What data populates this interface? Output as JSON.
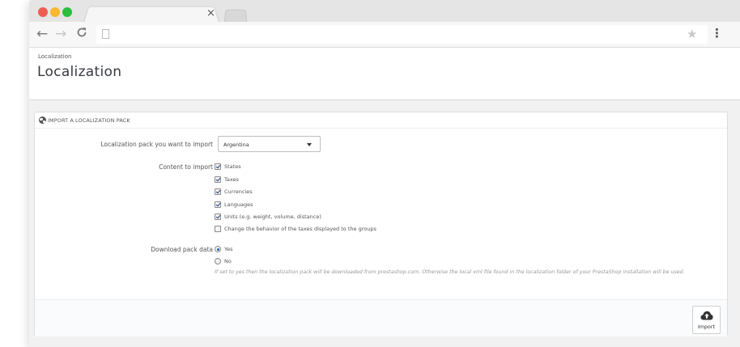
{
  "browser": {
    "tab_close": "×",
    "nav": {
      "back": "←",
      "forward": "→",
      "reload": "C"
    },
    "star": "★",
    "menu": "⋮"
  },
  "header": {
    "breadcrumb": "Localization",
    "title": "Localization"
  },
  "panel": {
    "title": "IMPORT A LOCALIZATION PACK",
    "pack_label": "Localization pack you want to import",
    "pack_selected": "Argentina",
    "content_label": "Content to import",
    "content_items": [
      {
        "label": "States",
        "checked": true
      },
      {
        "label": "Taxes",
        "checked": true
      },
      {
        "label": "Currencies",
        "checked": true
      },
      {
        "label": "Languages",
        "checked": true
      },
      {
        "label": "Units (e.g. weight, volume, distance)",
        "checked": true
      },
      {
        "label": "Change the behavior of the taxes displayed to the groups",
        "checked": false
      }
    ],
    "download_label": "Download pack data",
    "download_options": [
      {
        "label": "Yes",
        "checked": true
      },
      {
        "label": "No",
        "checked": false
      }
    ],
    "help_text": "If set to yes then the localization pack will be downloaded from prestashop.com. Otherwise the local xml file found in the localization folder of your PrestaShop installation will be used.",
    "import_label": "Import"
  },
  "colors": {
    "close": "#ee5c54",
    "minimize": "#f7b82d",
    "maximize": "#28c03b",
    "accent": "#1c5fb0"
  }
}
